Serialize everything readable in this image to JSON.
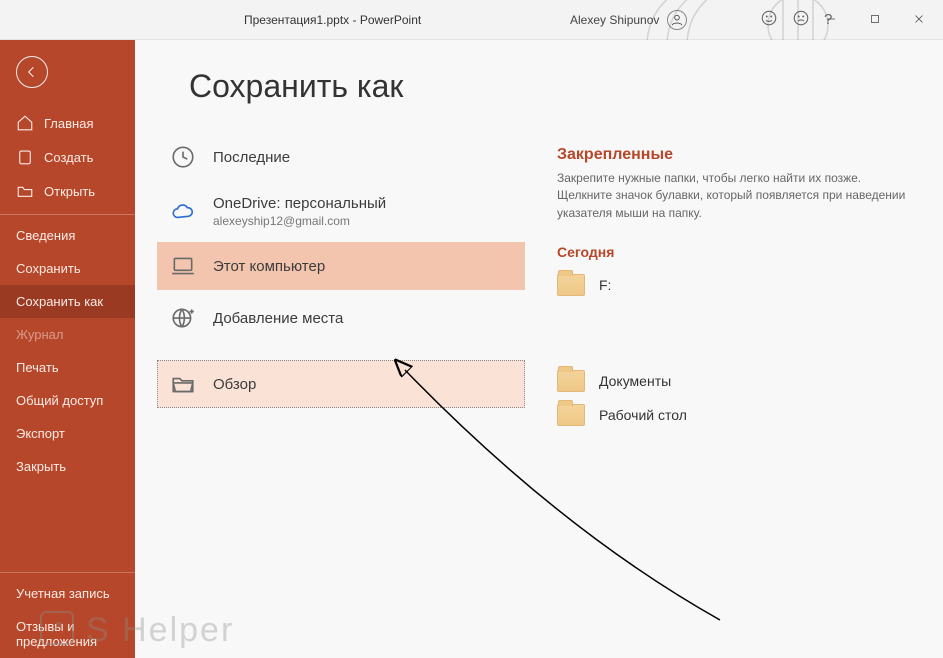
{
  "titlebar": {
    "document": "Презентация1.pptx  -  PowerPoint",
    "user": "Alexey Shipunov"
  },
  "sidebar": {
    "primary": [
      {
        "label": "Главная"
      },
      {
        "label": "Создать"
      },
      {
        "label": "Открыть"
      }
    ],
    "secondary": [
      {
        "label": "Сведения"
      },
      {
        "label": "Сохранить"
      },
      {
        "label": "Сохранить как",
        "active": true
      },
      {
        "label": "Журнал",
        "muted": true
      },
      {
        "label": "Печать"
      },
      {
        "label": "Общий доступ"
      },
      {
        "label": "Экспорт"
      },
      {
        "label": "Закрыть"
      }
    ],
    "footer": [
      {
        "label": "Учетная запись"
      },
      {
        "label": "Отзывы и предложения"
      }
    ]
  },
  "page": {
    "title": "Сохранить как",
    "locations": [
      {
        "label": "Последние"
      },
      {
        "label": "OneDrive: персональный",
        "sub": "alexeyship12@gmail.com"
      },
      {
        "label": "Этот компьютер",
        "selected": true
      },
      {
        "label": "Добавление места"
      },
      {
        "label": "Обзор",
        "hover": true
      }
    ],
    "pinned": {
      "header": "Закрепленные",
      "desc": "Закрепите нужные папки, чтобы легко найти их позже. Щелкните значок булавки, который появляется при наведении указателя мыши на папку."
    },
    "today": {
      "header": "Сегодня",
      "items": [
        {
          "label": "F:"
        }
      ]
    },
    "other_folders": [
      {
        "label": "Документы"
      },
      {
        "label": "Рабочий стол"
      }
    ]
  },
  "watermark": "S Helper"
}
